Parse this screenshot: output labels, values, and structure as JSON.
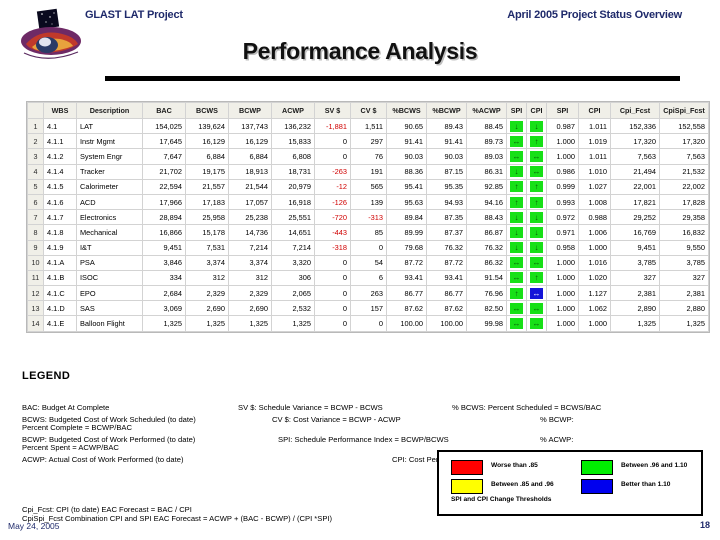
{
  "header": {
    "left_title": "GLAST LAT Project",
    "right_title": "April 2005 Project Status Overview",
    "slide_title": "Performance Analysis",
    "logo_alt": "glast-lat-logo"
  },
  "table": {
    "columns": [
      "",
      "WBS",
      "Description",
      "BAC",
      "BCWS",
      "BCWP",
      "ACWP",
      "SV $",
      "CV $",
      "%BCWS",
      "%BCWP",
      "%ACWP",
      "SPI",
      "CPI",
      "SPI",
      "CPI",
      "Cpi_Fcst",
      "CpiSpi_Fcst"
    ],
    "rows": [
      {
        "n": "1",
        "wbs": "4.1",
        "desc": "LAT",
        "bac": "154,025",
        "bcws": "139,624",
        "bcwp": "137,743",
        "acwp": "136,232",
        "sv": "-1,881",
        "cv": "1,511",
        "pbcws": "90.65",
        "pbcwp": "89.43",
        "pacwp": "88.45",
        "spi_i": {
          "dir": "down",
          "color": "green"
        },
        "cpi_i": {
          "dir": "down",
          "color": "green"
        },
        "spi": "0.987",
        "cpi": "1.011",
        "cpi_f": "152,336",
        "cpispi_f": "152,558"
      },
      {
        "n": "2",
        "wbs": "4.1.1",
        "desc": "Instr Mgmt",
        "bac": "17,645",
        "bcws": "16,129",
        "bcwp": "16,129",
        "acwp": "15,833",
        "sv": "0",
        "cv": "297",
        "pbcws": "91.41",
        "pbcwp": "91.41",
        "pacwp": "89.73",
        "spi_i": {
          "dir": "flat",
          "color": "green"
        },
        "cpi_i": {
          "dir": "up",
          "color": "green"
        },
        "spi": "1.000",
        "cpi": "1.019",
        "cpi_f": "17,320",
        "cpispi_f": "17,320"
      },
      {
        "n": "3",
        "wbs": "4.1.2",
        "desc": "System Engr",
        "bac": "7,647",
        "bcws": "6,884",
        "bcwp": "6,884",
        "acwp": "6,808",
        "sv": "0",
        "cv": "76",
        "pbcws": "90.03",
        "pbcwp": "90.03",
        "pacwp": "89.03",
        "spi_i": {
          "dir": "flat",
          "color": "green"
        },
        "cpi_i": {
          "dir": "flat",
          "color": "green"
        },
        "spi": "1.000",
        "cpi": "1.011",
        "cpi_f": "7,563",
        "cpispi_f": "7,563"
      },
      {
        "n": "4",
        "wbs": "4.1.4",
        "desc": "Tracker",
        "bac": "21,702",
        "bcws": "19,175",
        "bcwp": "18,913",
        "acwp": "18,731",
        "sv": "-263",
        "cv": "191",
        "pbcws": "88.36",
        "pbcwp": "87.15",
        "pacwp": "86.31",
        "spi_i": {
          "dir": "down",
          "color": "green"
        },
        "cpi_i": {
          "dir": "flat",
          "color": "green"
        },
        "spi": "0.986",
        "cpi": "1.010",
        "cpi_f": "21,494",
        "cpispi_f": "21,532"
      },
      {
        "n": "5",
        "wbs": "4.1.5",
        "desc": "Calorimeter",
        "bac": "22,594",
        "bcws": "21,557",
        "bcwp": "21,544",
        "acwp": "20,979",
        "sv": "-12",
        "cv": "565",
        "pbcws": "95.41",
        "pbcwp": "95.35",
        "pacwp": "92.85",
        "spi_i": {
          "dir": "up",
          "color": "green"
        },
        "cpi_i": {
          "dir": "up",
          "color": "green"
        },
        "spi": "0.999",
        "cpi": "1.027",
        "cpi_f": "22,001",
        "cpispi_f": "22,002"
      },
      {
        "n": "6",
        "wbs": "4.1.6",
        "desc": "ACD",
        "bac": "17,966",
        "bcws": "17,183",
        "bcwp": "17,057",
        "acwp": "16,918",
        "sv": "-126",
        "cv": "139",
        "pbcws": "95.63",
        "pbcwp": "94.93",
        "pacwp": "94.16",
        "spi_i": {
          "dir": "up",
          "color": "green"
        },
        "cpi_i": {
          "dir": "up",
          "color": "green"
        },
        "spi": "0.993",
        "cpi": "1.008",
        "cpi_f": "17,821",
        "cpispi_f": "17,828"
      },
      {
        "n": "7",
        "wbs": "4.1.7",
        "desc": "Electronics",
        "bac": "28,894",
        "bcws": "25,958",
        "bcwp": "25,238",
        "acwp": "25,551",
        "sv": "-720",
        "cv": "-313",
        "pbcws": "89.84",
        "pbcwp": "87.35",
        "pacwp": "88.43",
        "spi_i": {
          "dir": "down",
          "color": "green"
        },
        "cpi_i": {
          "dir": "down",
          "color": "green"
        },
        "spi": "0.972",
        "cpi": "0.988",
        "cpi_f": "29,252",
        "cpispi_f": "29,358"
      },
      {
        "n": "8",
        "wbs": "4.1.8",
        "desc": "Mechanical",
        "bac": "16,866",
        "bcws": "15,178",
        "bcwp": "14,736",
        "acwp": "14,651",
        "sv": "-443",
        "cv": "85",
        "pbcws": "89.99",
        "pbcwp": "87.37",
        "pacwp": "86.87",
        "spi_i": {
          "dir": "down",
          "color": "green"
        },
        "cpi_i": {
          "dir": "down",
          "color": "green"
        },
        "spi": "0.971",
        "cpi": "1.006",
        "cpi_f": "16,769",
        "cpispi_f": "16,832"
      },
      {
        "n": "9",
        "wbs": "4.1.9",
        "desc": "I&T",
        "bac": "9,451",
        "bcws": "7,531",
        "bcwp": "7,214",
        "acwp": "7,214",
        "sv": "-318",
        "cv": "0",
        "pbcws": "79.68",
        "pbcwp": "76.32",
        "pacwp": "76.32",
        "spi_i": {
          "dir": "down",
          "color": "green"
        },
        "cpi_i": {
          "dir": "down",
          "color": "green"
        },
        "spi": "0.958",
        "cpi": "1.000",
        "cpi_f": "9,451",
        "cpispi_f": "9,550"
      },
      {
        "n": "10",
        "wbs": "4.1.A",
        "desc": "PSA",
        "bac": "3,846",
        "bcws": "3,374",
        "bcwp": "3,374",
        "acwp": "3,320",
        "sv": "0",
        "cv": "54",
        "pbcws": "87.72",
        "pbcwp": "87.72",
        "pacwp": "86.32",
        "spi_i": {
          "dir": "flat",
          "color": "green"
        },
        "cpi_i": {
          "dir": "flat",
          "color": "green"
        },
        "spi": "1.000",
        "cpi": "1.016",
        "cpi_f": "3,785",
        "cpispi_f": "3,785"
      },
      {
        "n": "11",
        "wbs": "4.1.B",
        "desc": "ISOC",
        "bac": "334",
        "bcws": "312",
        "bcwp": "312",
        "acwp": "306",
        "sv": "0",
        "cv": "6",
        "pbcws": "93.41",
        "pbcwp": "93.41",
        "pacwp": "91.54",
        "spi_i": {
          "dir": "flat",
          "color": "green"
        },
        "cpi_i": {
          "dir": "up",
          "color": "green"
        },
        "spi": "1.000",
        "cpi": "1.020",
        "cpi_f": "327",
        "cpispi_f": "327"
      },
      {
        "n": "12",
        "wbs": "4.1.C",
        "desc": "EPO",
        "bac": "2,684",
        "bcws": "2,329",
        "bcwp": "2,329",
        "acwp": "2,065",
        "sv": "0",
        "cv": "263",
        "pbcws": "86.77",
        "pbcwp": "86.77",
        "pacwp": "76.96",
        "spi_i": {
          "dir": "up",
          "color": "green"
        },
        "cpi_i": {
          "dir": "flat",
          "color": "blue"
        },
        "spi": "1.000",
        "cpi": "1.127",
        "cpi_f": "2,381",
        "cpispi_f": "2,381"
      },
      {
        "n": "13",
        "wbs": "4.1.D",
        "desc": "SAS",
        "bac": "3,069",
        "bcws": "2,690",
        "bcwp": "2,690",
        "acwp": "2,532",
        "sv": "0",
        "cv": "157",
        "pbcws": "87.62",
        "pbcwp": "87.62",
        "pacwp": "82.50",
        "spi_i": {
          "dir": "flat",
          "color": "green"
        },
        "cpi_i": {
          "dir": "flat",
          "color": "green"
        },
        "spi": "1.000",
        "cpi": "1.062",
        "cpi_f": "2,890",
        "cpispi_f": "2,880"
      },
      {
        "n": "14",
        "wbs": "4.1.E",
        "desc": "Balloon Flight",
        "bac": "1,325",
        "bcws": "1,325",
        "bcwp": "1,325",
        "acwp": "1,325",
        "sv": "0",
        "cv": "0",
        "pbcws": "100.00",
        "pbcwp": "100.00",
        "pacwp": "99.98",
        "spi_i": {
          "dir": "flat",
          "color": "green"
        },
        "cpi_i": {
          "dir": "flat",
          "color": "green"
        },
        "spi": "1.000",
        "cpi": "1.000",
        "cpi_f": "1,325",
        "cpispi_f": "1,325"
      }
    ]
  },
  "legend": {
    "heading": "LEGEND",
    "line_bac": "BAC:  Budget At Complete",
    "line_bcws": "BCWS:  Budgeted Cost of Work Scheduled (to date)",
    "line_pct_complete": "Percent Complete = BCWP/BAC",
    "line_bcwp": "BCWP:  Budgeted Cost of Work Performed (to date)",
    "line_pct_spent": "Percent Spent = ACWP/BAC",
    "line_acwp": "ACWP:  Actual Cost of Work Performed (to date)",
    "line_sv": "SV $:  Schedule Variance = BCWP - BCWS",
    "line_cv": "CV $:  Cost Variance = BCWP - ACWP",
    "line_spi": "SPI:  Schedule Performance Index = BCWP/BCWS",
    "line_cpi": "CPI:  Cost Performance Index = BCWP/ACWP",
    "line_pct_bcws": "% BCWS:  Percent Scheduled = BCWS/BAC",
    "line_pct_bcwp": "% BCWP:",
    "line_pct_acwp": "% ACWP:",
    "line_cpi_fcst": "Cpi_Fcst:  CPI (to date) EAC Forecast = BAC / CPI",
    "line_cpispi_fcst": "CpiSpi_Fcst  Combination CPI and SPI EAC Forecast = ACWP + (BAC - BCWP) / (CPI *SPI)"
  },
  "thresholds": {
    "note": "SPI and CPI Change Thresholds",
    "items": [
      {
        "label": "Worse than .85",
        "color": "#ff0000"
      },
      {
        "label": "Between .85 and .96",
        "color": "#ffff00"
      },
      {
        "label": "Between .96 and 1.10",
        "color": "#00ee00"
      },
      {
        "label": "Better than 1.10",
        "color": "#0000ee"
      }
    ]
  },
  "footer": {
    "date": "May 24, 2005",
    "page": "18"
  }
}
